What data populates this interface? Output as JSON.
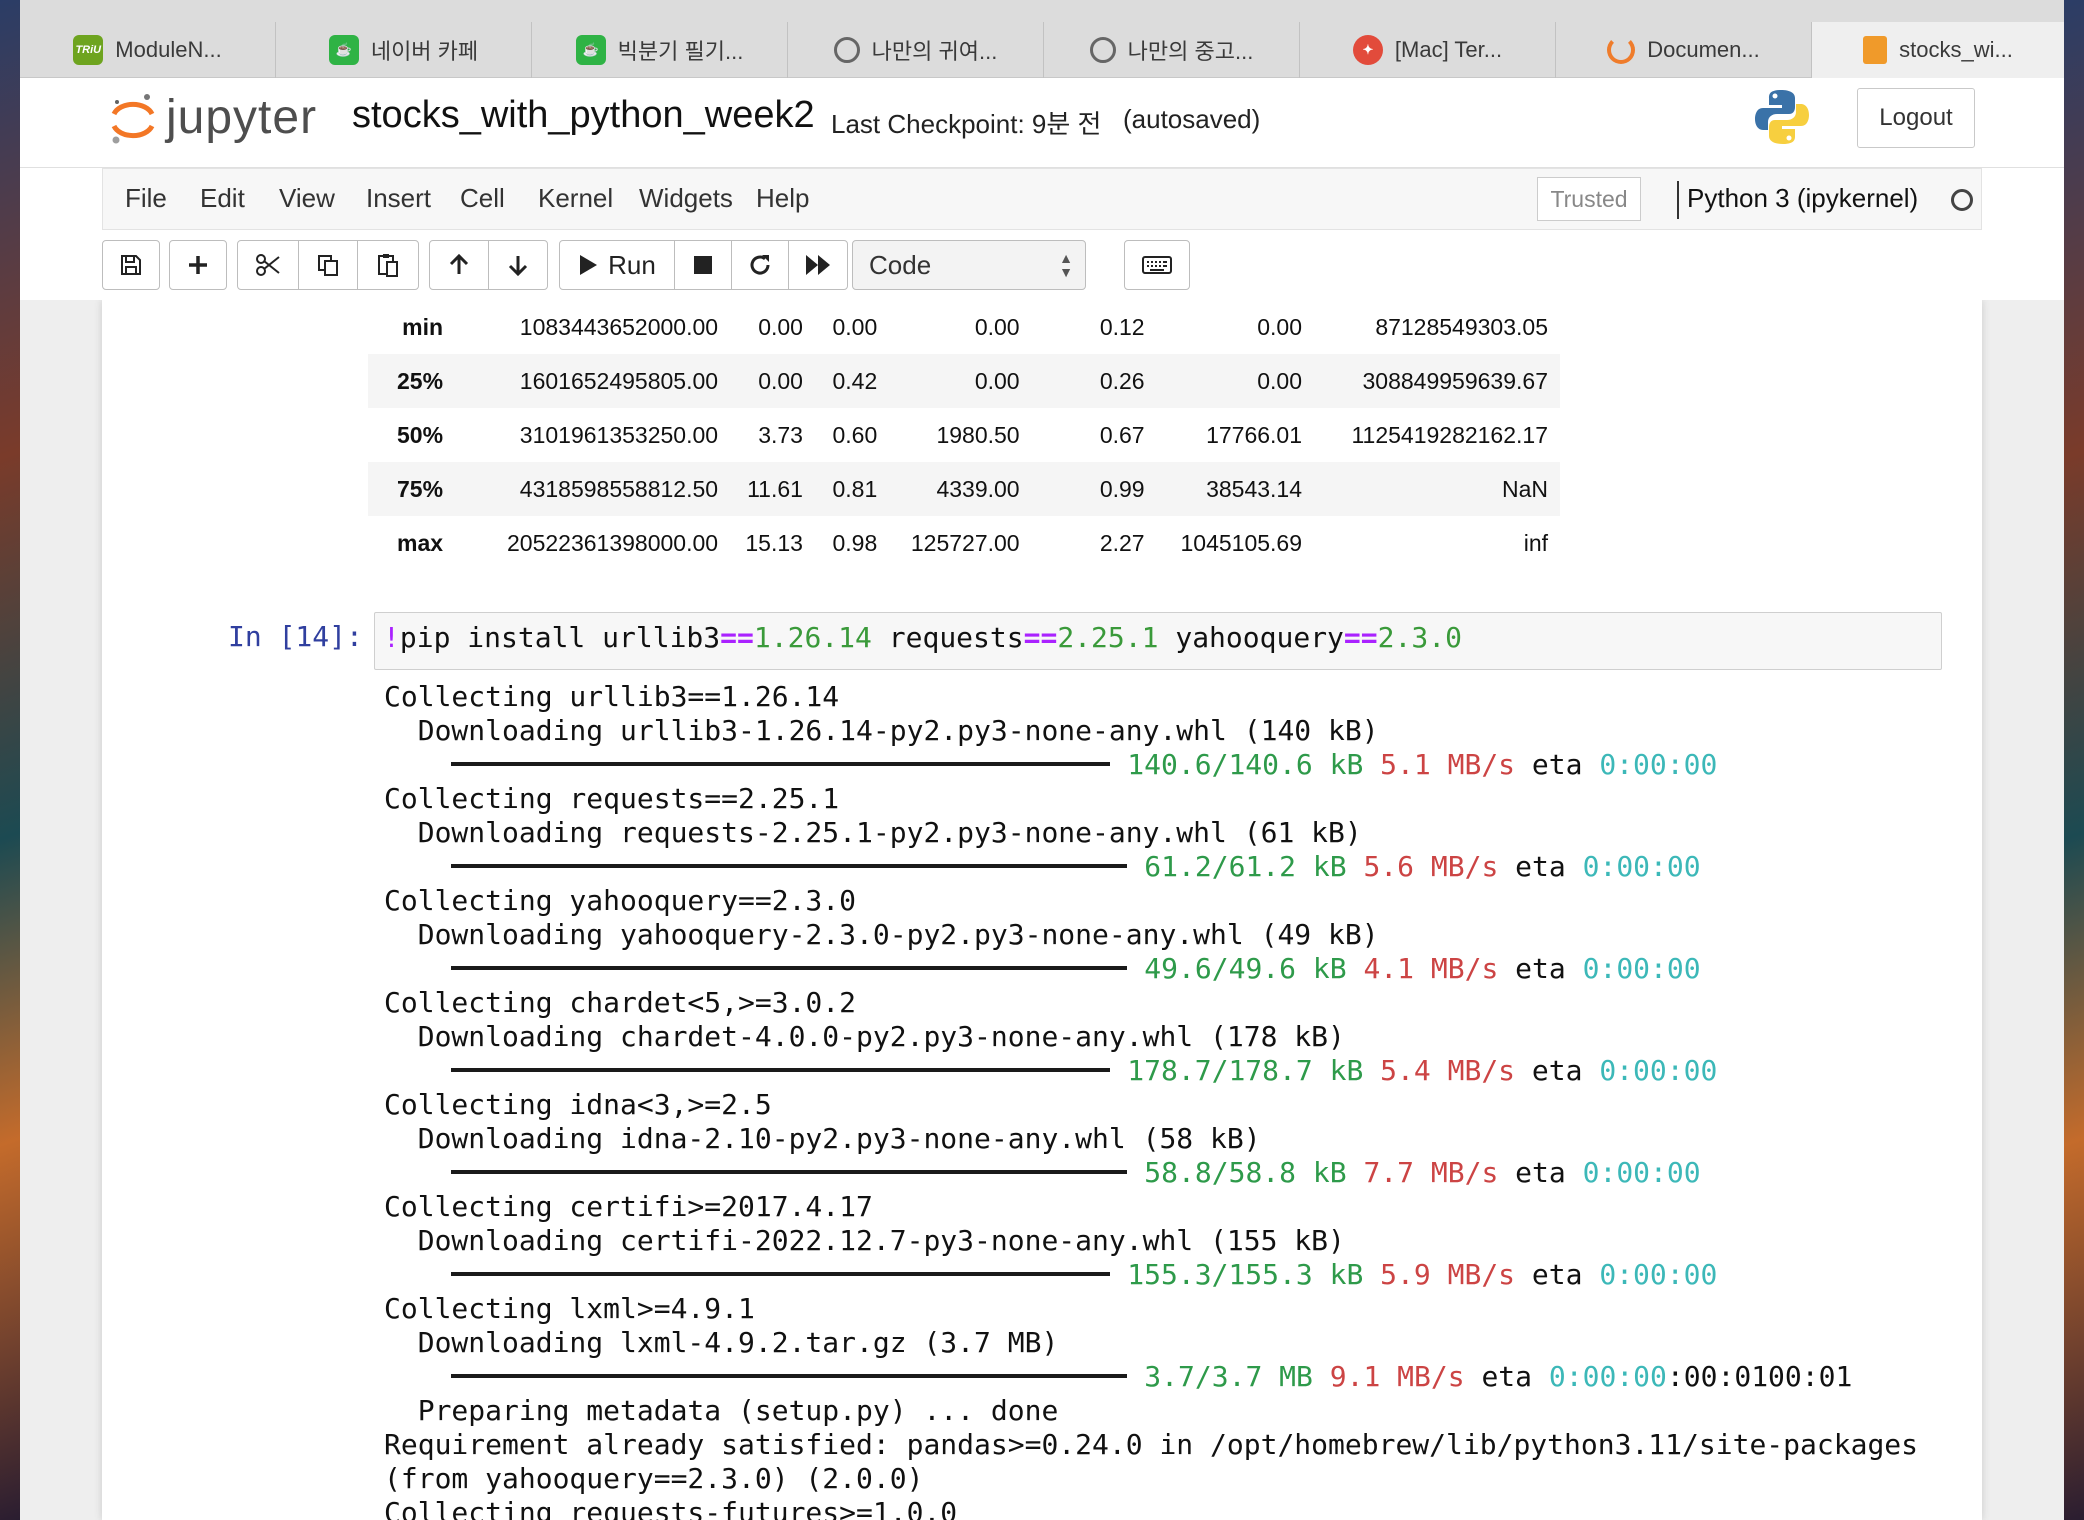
{
  "tabs": [
    {
      "label": "ModuleN...",
      "icon": "triu-favicon"
    },
    {
      "label": "네이버 카페",
      "icon": "naver-cafe-favicon"
    },
    {
      "label": "빅분기 필기...",
      "icon": "naver-cafe-favicon"
    },
    {
      "label": "나만의 귀여...",
      "icon": "compass-icon"
    },
    {
      "label": "나만의 중고...",
      "icon": "compass-icon"
    },
    {
      "label": "[Mac] Ter...",
      "icon": "red-circle-favicon"
    },
    {
      "label": "Documen...",
      "icon": "jupyter-ring-favicon"
    },
    {
      "label": "stocks_wi...",
      "icon": "book-favicon"
    }
  ],
  "header": {
    "logo_text": "jupyter",
    "notebook_title": "stocks_with_python_week2",
    "checkpoint": "Last Checkpoint: 9분 전",
    "autosave": "(autosaved)",
    "logout": "Logout"
  },
  "menubar": {
    "items": [
      "File",
      "Edit",
      "View",
      "Insert",
      "Cell",
      "Kernel",
      "Widgets",
      "Help"
    ],
    "trusted": "Trusted",
    "kernel": "Python 3 (ipykernel)"
  },
  "toolbar": {
    "run_label": "Run",
    "cell_type": "Code",
    "icons": [
      "save-icon",
      "plus-icon",
      "scissors-icon",
      "copy-icon",
      "paste-icon",
      "arrow-up-icon",
      "arrow-down-icon",
      "play-icon",
      "stop-icon",
      "restart-icon",
      "fast-forward-icon",
      "keyboard-icon"
    ]
  },
  "describe_table": {
    "rows": [
      {
        "label": "min",
        "cells": [
          "1083443652000.00",
          "0.00",
          "0.00",
          "0.00",
          "0.12",
          "0.00",
          "87128549303.05"
        ]
      },
      {
        "label": "25%",
        "cells": [
          "1601652495805.00",
          "0.00",
          "0.42",
          "0.00",
          "0.26",
          "0.00",
          "308849959639.67"
        ]
      },
      {
        "label": "50%",
        "cells": [
          "3101961353250.00",
          "3.73",
          "0.60",
          "1980.50",
          "0.67",
          "17766.01",
          "1125419282162.17"
        ]
      },
      {
        "label": "75%",
        "cells": [
          "4318598558812.50",
          "11.61",
          "0.81",
          "4339.00",
          "0.99",
          "38543.14",
          "NaN"
        ]
      },
      {
        "label": "max",
        "cells": [
          "20522361398000.00",
          "15.13",
          "0.98",
          "125727.00",
          "2.27",
          "1045105.69",
          "inf"
        ]
      }
    ]
  },
  "cell": {
    "prompt": "In [14]:",
    "code_bang": "!",
    "code_parts": [
      {
        "t": "pip install urllib3",
        "k": "plain"
      },
      {
        "t": "==",
        "k": "op"
      },
      {
        "t": "1.26.14",
        "k": "num"
      },
      {
        "t": " requests",
        "k": "plain"
      },
      {
        "t": "==",
        "k": "op"
      },
      {
        "t": "2.25.1",
        "k": "num"
      },
      {
        "t": " yahooquery",
        "k": "plain"
      },
      {
        "t": "==",
        "k": "op"
      },
      {
        "t": "2.3.0",
        "k": "num"
      }
    ]
  },
  "output": {
    "lines": [
      {
        "type": "text",
        "text": "Collecting urllib3==1.26.14"
      },
      {
        "type": "text",
        "text": "  Downloading urllib3-1.26.14-py2.py3-none-any.whl (140 kB)"
      },
      {
        "type": "progress",
        "bar_chars": 39,
        "size": "140.6/140.6 kB",
        "speed": "5.1 MB/s",
        "eta_label": "eta",
        "eta": "0:00:00",
        "tail": ""
      },
      {
        "type": "text",
        "text": "Collecting requests==2.25.1"
      },
      {
        "type": "text",
        "text": "  Downloading requests-2.25.1-py2.py3-none-any.whl (61 kB)"
      },
      {
        "type": "progress",
        "bar_chars": 40,
        "size": "61.2/61.2 kB",
        "speed": "5.6 MB/s",
        "eta_label": "eta",
        "eta": "0:00:00",
        "tail": ""
      },
      {
        "type": "text",
        "text": "Collecting yahooquery==2.3.0"
      },
      {
        "type": "text",
        "text": "  Downloading yahooquery-2.3.0-py2.py3-none-any.whl (49 kB)"
      },
      {
        "type": "progress",
        "bar_chars": 40,
        "size": "49.6/49.6 kB",
        "speed": "4.1 MB/s",
        "eta_label": "eta",
        "eta": "0:00:00",
        "tail": ""
      },
      {
        "type": "text",
        "text": "Collecting chardet<5,>=3.0.2"
      },
      {
        "type": "text",
        "text": "  Downloading chardet-4.0.0-py2.py3-none-any.whl (178 kB)"
      },
      {
        "type": "progress",
        "bar_chars": 39,
        "size": "178.7/178.7 kB",
        "speed": "5.4 MB/s",
        "eta_label": "eta",
        "eta": "0:00:00",
        "tail": ""
      },
      {
        "type": "text",
        "text": "Collecting idna<3,>=2.5"
      },
      {
        "type": "text",
        "text": "  Downloading idna-2.10-py2.py3-none-any.whl (58 kB)"
      },
      {
        "type": "progress",
        "bar_chars": 40,
        "size": "58.8/58.8 kB",
        "speed": "7.7 MB/s",
        "eta_label": "eta",
        "eta": "0:00:00",
        "tail": ""
      },
      {
        "type": "text",
        "text": "Collecting certifi>=2017.4.17"
      },
      {
        "type": "text",
        "text": "  Downloading certifi-2022.12.7-py3-none-any.whl (155 kB)"
      },
      {
        "type": "progress",
        "bar_chars": 39,
        "size": "155.3/155.3 kB",
        "speed": "5.9 MB/s",
        "eta_label": "eta",
        "eta": "0:00:00",
        "tail": ""
      },
      {
        "type": "text",
        "text": "Collecting lxml>=4.9.1"
      },
      {
        "type": "text",
        "text": "  Downloading lxml-4.9.2.tar.gz (3.7 MB)"
      },
      {
        "type": "progress",
        "bar_chars": 40,
        "size": "3.7/3.7 MB",
        "speed": "9.1 MB/s",
        "eta_label": "eta",
        "eta": "0:00:00",
        "tail": ":00:0100:01"
      },
      {
        "type": "text",
        "text": "  Preparing metadata (setup.py) ... done"
      },
      {
        "type": "text",
        "text": "Requirement already satisfied: pandas>=0.24.0 in /opt/homebrew/lib/python3.11/site-packages"
      },
      {
        "type": "text",
        "text": "(from yahooquery==2.3.0) (2.0.0)"
      },
      {
        "type": "text",
        "text": "Collecting requests-futures>=1.0.0"
      }
    ]
  }
}
